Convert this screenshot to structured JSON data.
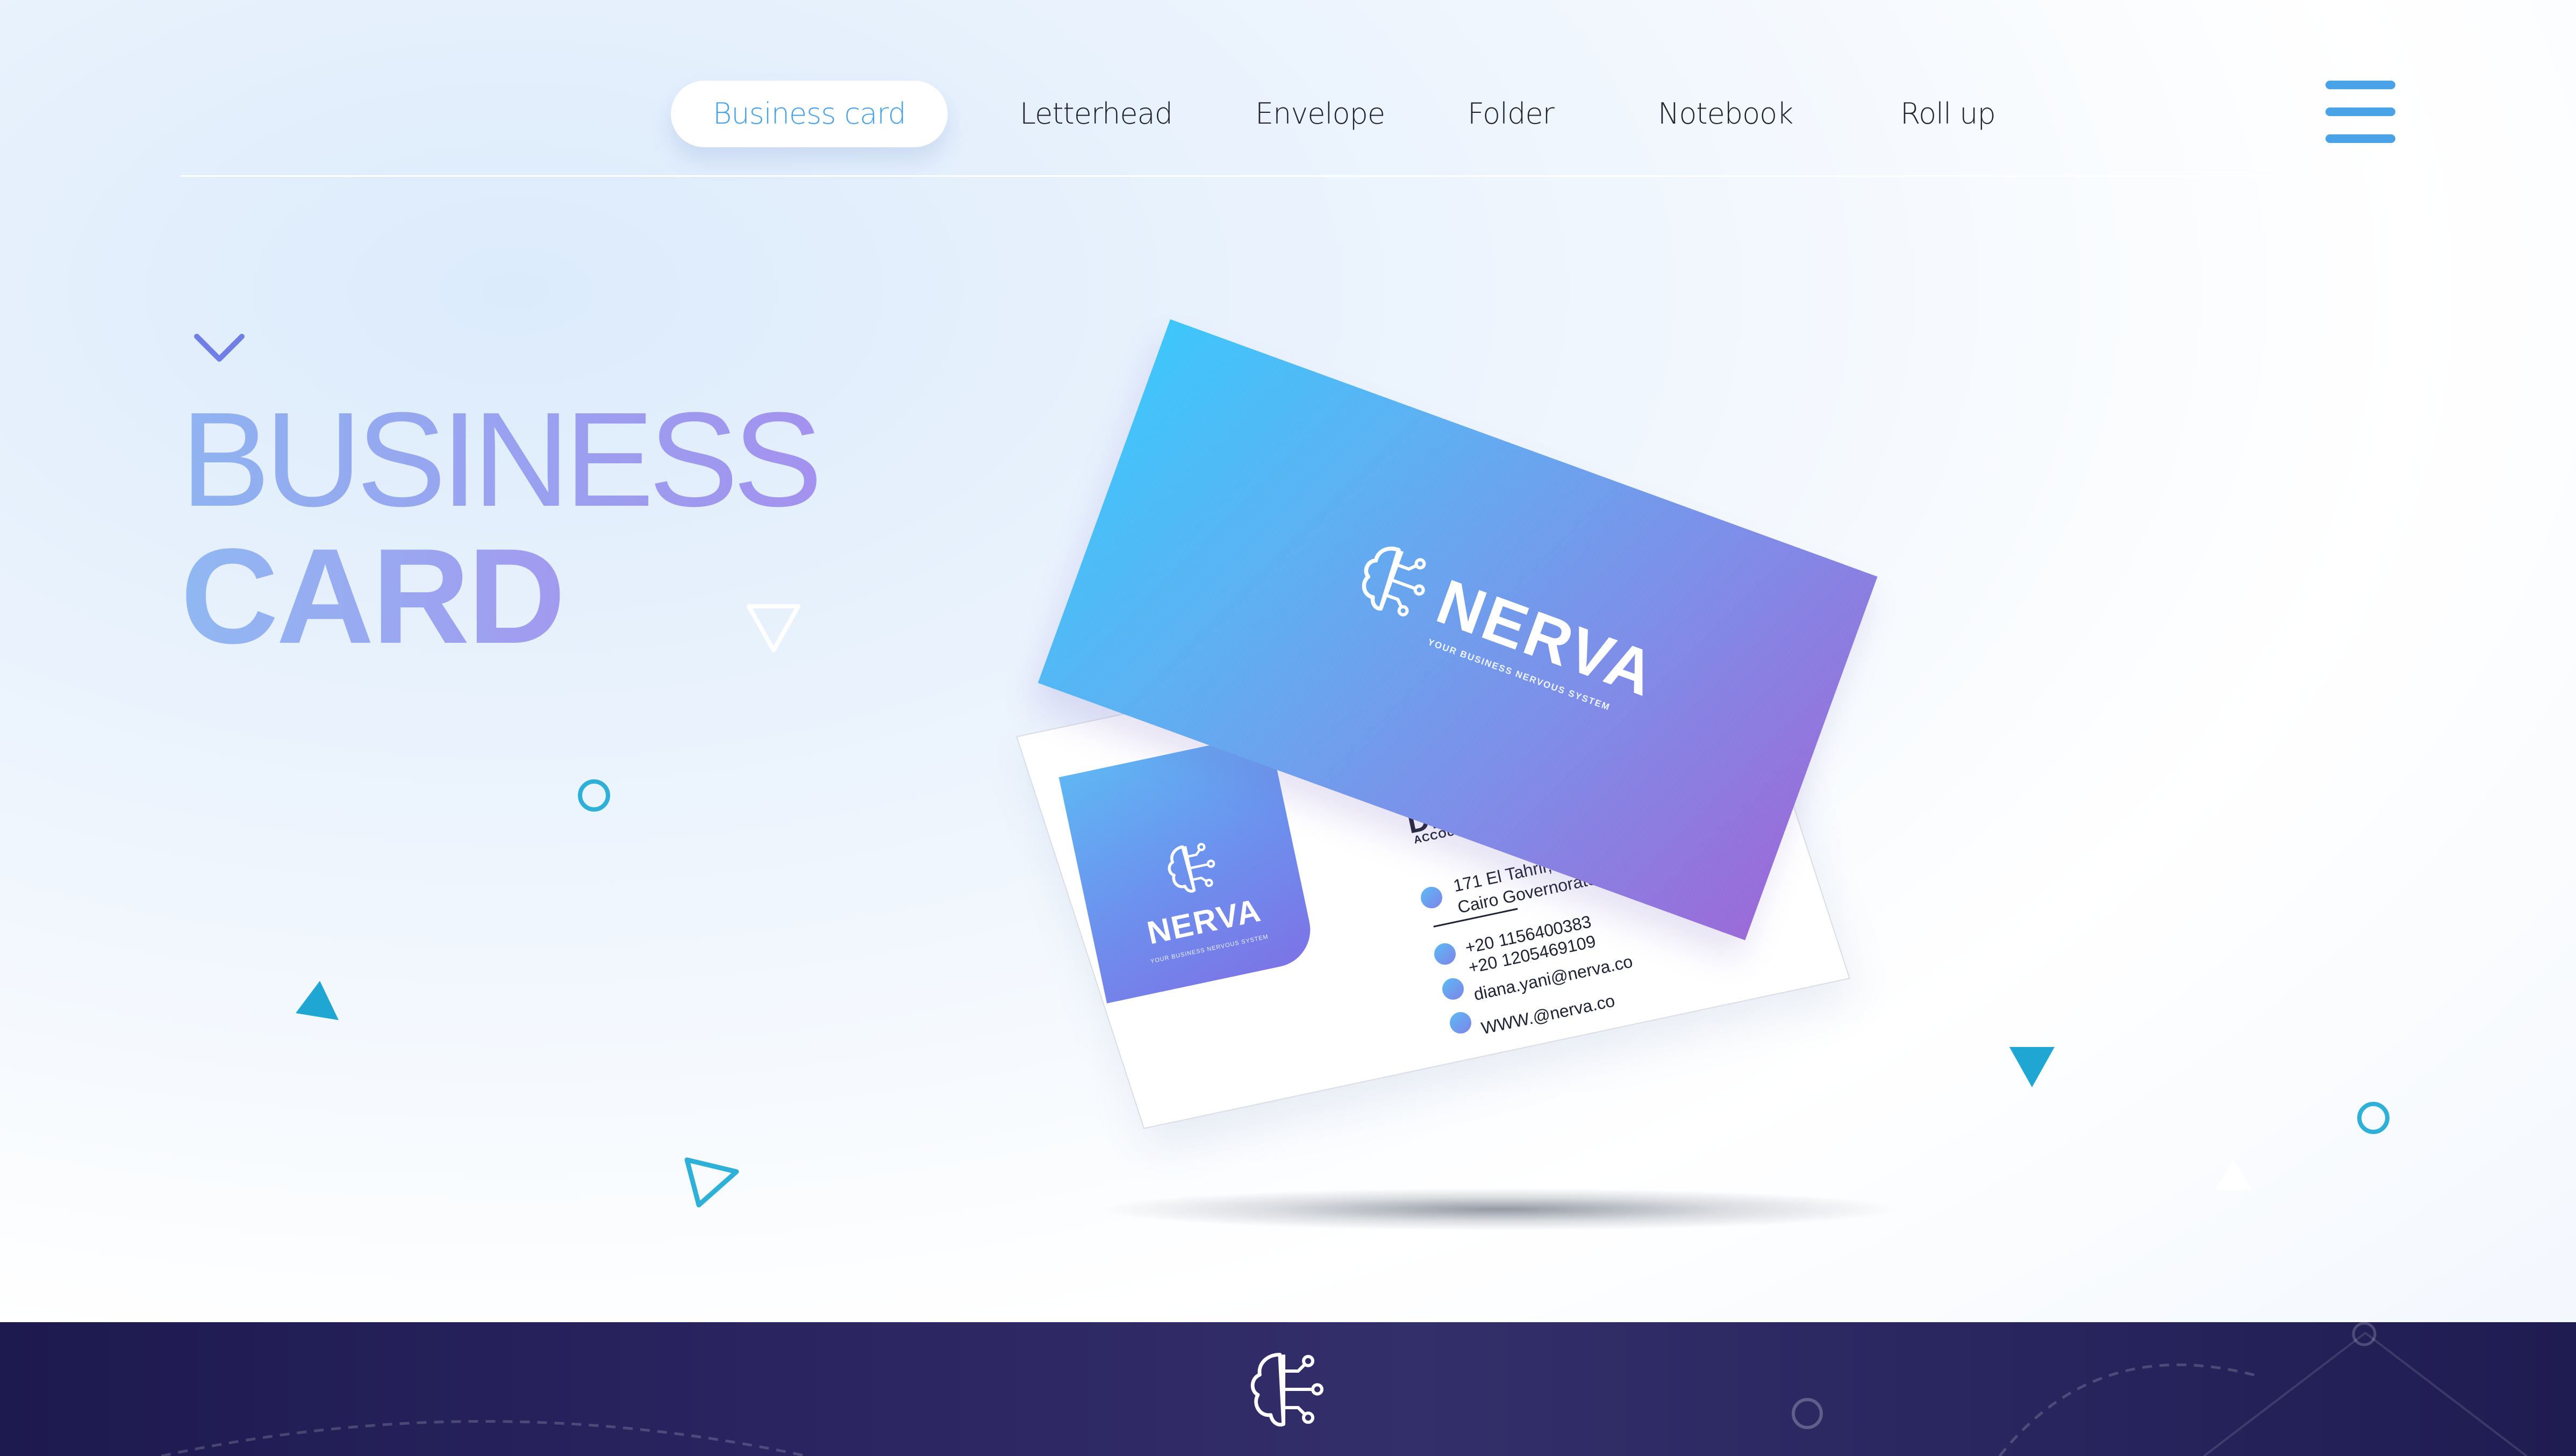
{
  "nav": {
    "items": [
      {
        "label": "Business card",
        "active": true
      },
      {
        "label": "Letterhead",
        "active": false
      },
      {
        "label": "Envelope",
        "active": false
      },
      {
        "label": "Folder",
        "active": false
      },
      {
        "label": "Notebook",
        "active": false
      },
      {
        "label": "Roll up",
        "active": false
      }
    ],
    "menu_icon": "hamburger-menu-icon"
  },
  "heading": {
    "line1": "BUSINESS",
    "line2": "CARD",
    "scroll_icon": "chevron-down-icon"
  },
  "card_front": {
    "brand": "NERVA",
    "tagline": "YOUR BUSINESS NERVOUS SYSTEM",
    "logo_icon": "brain-circuit-icon"
  },
  "card_back": {
    "brand": "NERVA",
    "tagline": "YOUR BUSINESS NERVOUS SYSTEM",
    "name": "Diana Sa",
    "role": "ACCOUNTING ADVISORY SP",
    "address_line1": "171 El Tahrir, Abdeen,",
    "address_line2": "Cairo Governorate",
    "phone1": "+20 1156400383",
    "phone2": "+20 1205469109",
    "email": "diana.yani@nerva.co",
    "website": "WWW.@nerva.co"
  },
  "footer": {
    "logo_icon": "brain-circuit-icon"
  },
  "colors": {
    "accent": "#4aa3e6",
    "decoration": "#2fb0d8",
    "footer": "#1f1c52",
    "card_gradient_start": "#3dc6fb",
    "card_gradient_end": "#9a6ad8"
  }
}
